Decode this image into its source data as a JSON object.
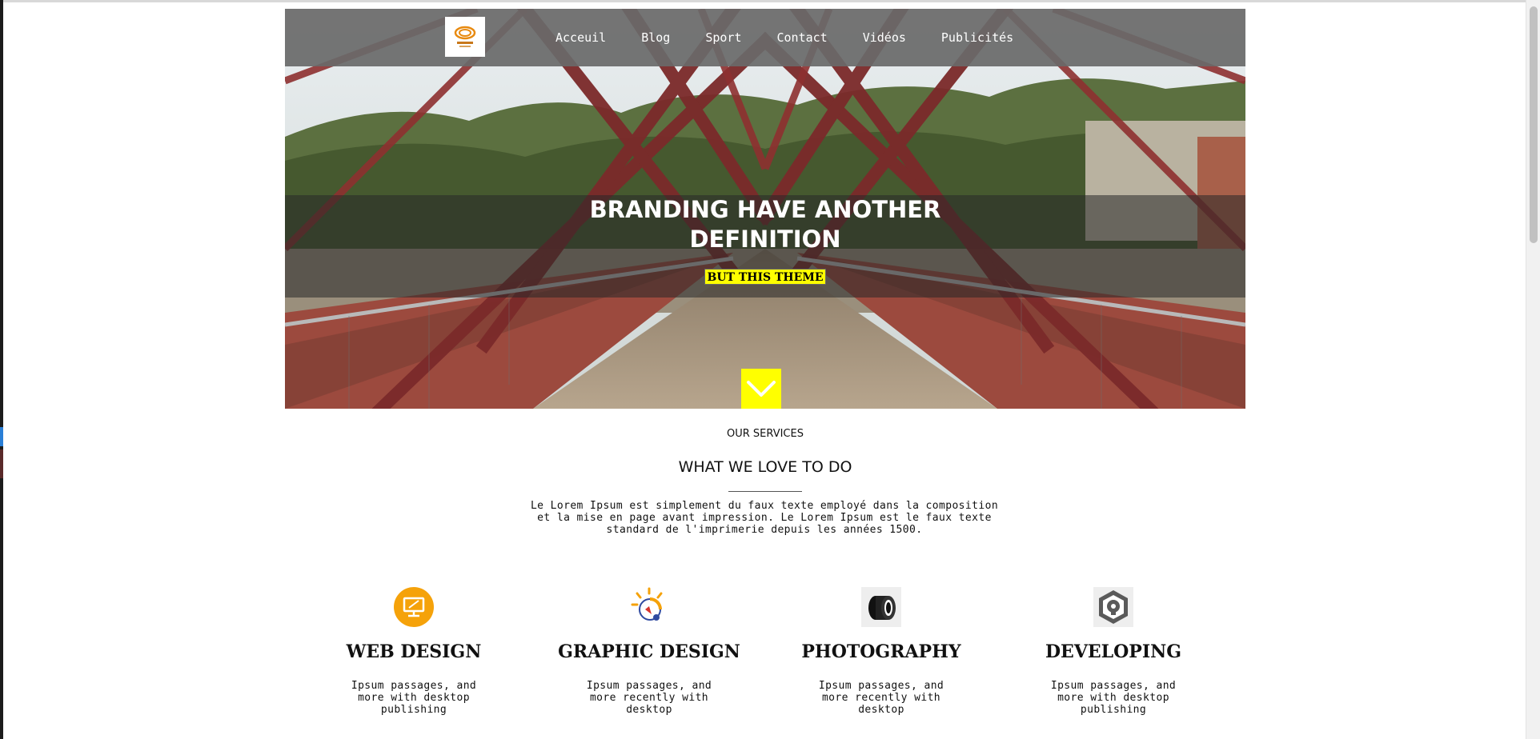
{
  "nav": {
    "logo_text": "LOGO",
    "items": [
      {
        "label": "Acceuil"
      },
      {
        "label": "Blog"
      },
      {
        "label": "Sport"
      },
      {
        "label": "Contact"
      },
      {
        "label": "Vidéos"
      },
      {
        "label": "Publicités"
      }
    ]
  },
  "hero": {
    "title_line1": "BRANDING HAVE ANOTHER",
    "title_line2": "DEFINITION",
    "cta_label": "BUT THIS THEME",
    "scroll_icon": "chevron-down-icon"
  },
  "services": {
    "kicker": "OUR SERVICES",
    "title": "WHAT WE LOVE TO DO",
    "description": "Le Lorem Ipsum est simplement du faux texte employé dans la composition et la mise en page avant impression. Le Lorem Ipsum est le faux texte standard de l'imprimerie depuis les années 1500.",
    "items": [
      {
        "title": "WEB DESIGN",
        "text": "Ipsum passages, and more with desktop publishing",
        "icon": "monitor-icon"
      },
      {
        "title": "GRAPHIC DESIGN",
        "text": "Ipsum passages, and more recently with desktop",
        "icon": "palette-icon"
      },
      {
        "title": "PHOTOGRAPHY",
        "text": "Ipsum passages, and more recently with desktop",
        "icon": "camera-lens-icon"
      },
      {
        "title": "DEVELOPING",
        "text": "Ipsum passages, and more with desktop publishing",
        "icon": "gear-head-icon"
      }
    ]
  },
  "colors": {
    "accent": "#ffff00",
    "nav_bg": "#696969",
    "icon_orange": "#f5a20a"
  }
}
